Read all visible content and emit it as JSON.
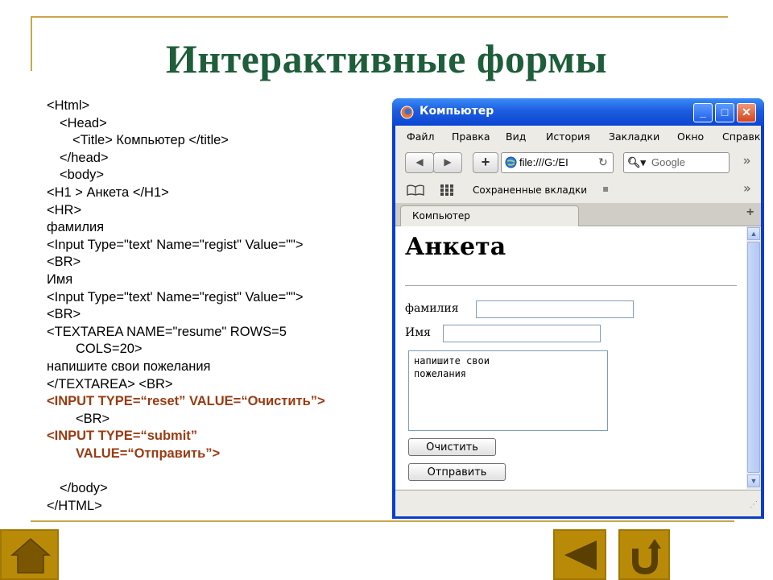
{
  "slide": {
    "title": "Интерактивные формы",
    "accent_color": "#c8a64a",
    "title_color": "#1e5e3a"
  },
  "code_lines": [
    {
      "text": "<Html>",
      "indent": 0,
      "highlight": false
    },
    {
      "text": "<Head>",
      "indent": 1,
      "highlight": false
    },
    {
      "text": "<Title> Компьютер </title>",
      "indent": 2,
      "highlight": false
    },
    {
      "text": "</head>",
      "indent": 1,
      "highlight": false
    },
    {
      "text": "<body>",
      "indent": 1,
      "highlight": false
    },
    {
      "text": "<H1 > Анкета </H1>",
      "indent": 0,
      "highlight": false
    },
    {
      "text": "<HR>",
      "indent": 0,
      "highlight": false
    },
    {
      "text": "фамилия",
      "indent": 0,
      "highlight": false
    },
    {
      "text": "<Input Type=\"text' Name=\"regist\" Value=\"\">",
      "indent": 0,
      "highlight": false
    },
    {
      "text": "<BR>",
      "indent": 0,
      "highlight": false
    },
    {
      "text": "Имя",
      "indent": 0,
      "highlight": false
    },
    {
      "text": "<Input Type=\"text' Name=\"regist\" Value=\"\">",
      "indent": 0,
      "highlight": false
    },
    {
      "text": "<BR>",
      "indent": 0,
      "highlight": false
    },
    {
      "text": "<TEXTAREA NAME=\"resume\" ROWS=5",
      "indent": 0,
      "highlight": false
    },
    {
      "text": "COLS=20>",
      "indent": 3,
      "highlight": false
    },
    {
      "text": "напишите свои пожелания",
      "indent": 0,
      "highlight": false
    },
    {
      "text": "</TEXTAREA> <BR>",
      "indent": 0,
      "highlight": false
    },
    {
      "text": "<INPUT TYPE=“reset” VALUE=“Очистить”>",
      "indent": 0,
      "highlight": true
    },
    {
      "text": "<BR>",
      "indent": 3,
      "highlight": false
    },
    {
      "text": "<INPUT TYPE=“submit”",
      "indent": 0,
      "highlight": true
    },
    {
      "text": "VALUE=“Отправить”>",
      "indent": 3,
      "highlight": true
    },
    {
      "text": "</body>",
      "indent": 1,
      "highlight": false
    },
    {
      "text": "</HTML>",
      "indent": 0,
      "highlight": false
    }
  ],
  "browser": {
    "window_title": "Компьютер",
    "menu": [
      "Файл",
      "Правка",
      "Вид",
      "История",
      "Закладки",
      "Окно",
      "Справк"
    ],
    "url": "file:///G:/EI",
    "search_placeholder": "Google",
    "bookmarks_label": "Сохраненные вкладки",
    "tab_label": "Компьютер",
    "page": {
      "heading": "Анкета",
      "surname_label": "фамилия",
      "name_label": "Имя",
      "textarea_value": "напишите свои\nпожелания",
      "reset_label": "Очистить",
      "submit_label": "Отправить"
    }
  }
}
